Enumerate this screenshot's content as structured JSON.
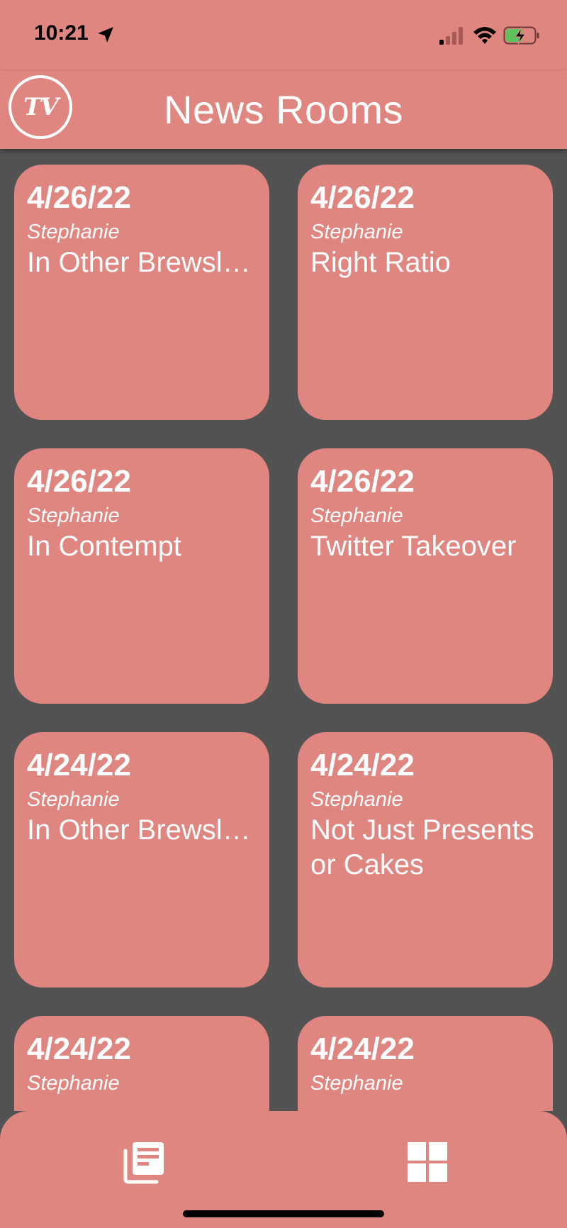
{
  "status_bar": {
    "time": "10:21"
  },
  "header": {
    "logo_icon": "tv-logo-icon",
    "title": "News Rooms"
  },
  "cards": [
    {
      "date": "4/26/22",
      "author": "Stephanie",
      "title": "In Other Brewsletters"
    },
    {
      "date": "4/26/22",
      "author": "Stephanie",
      "title": "Right Ratio"
    },
    {
      "date": "4/26/22",
      "author": "Stephanie",
      "title": "In Contempt"
    },
    {
      "date": "4/26/22",
      "author": "Stephanie",
      "title": "Twitter Takeover"
    },
    {
      "date": "4/24/22",
      "author": "Stephanie",
      "title": "In Other Brewsletters"
    },
    {
      "date": "4/24/22",
      "author": "Stephanie",
      "title": "Not Just Presents or Cakes"
    },
    {
      "date": "4/24/22",
      "author": "Stephanie",
      "title": ""
    },
    {
      "date": "4/24/22",
      "author": "Stephanie",
      "title": ""
    }
  ],
  "bottom_nav": {
    "items": [
      {
        "icon": "newspaper-icon"
      },
      {
        "icon": "grid-icon"
      }
    ]
  },
  "colors": {
    "accent": "#e08680",
    "background": "#525252",
    "text": "#ffffff"
  }
}
